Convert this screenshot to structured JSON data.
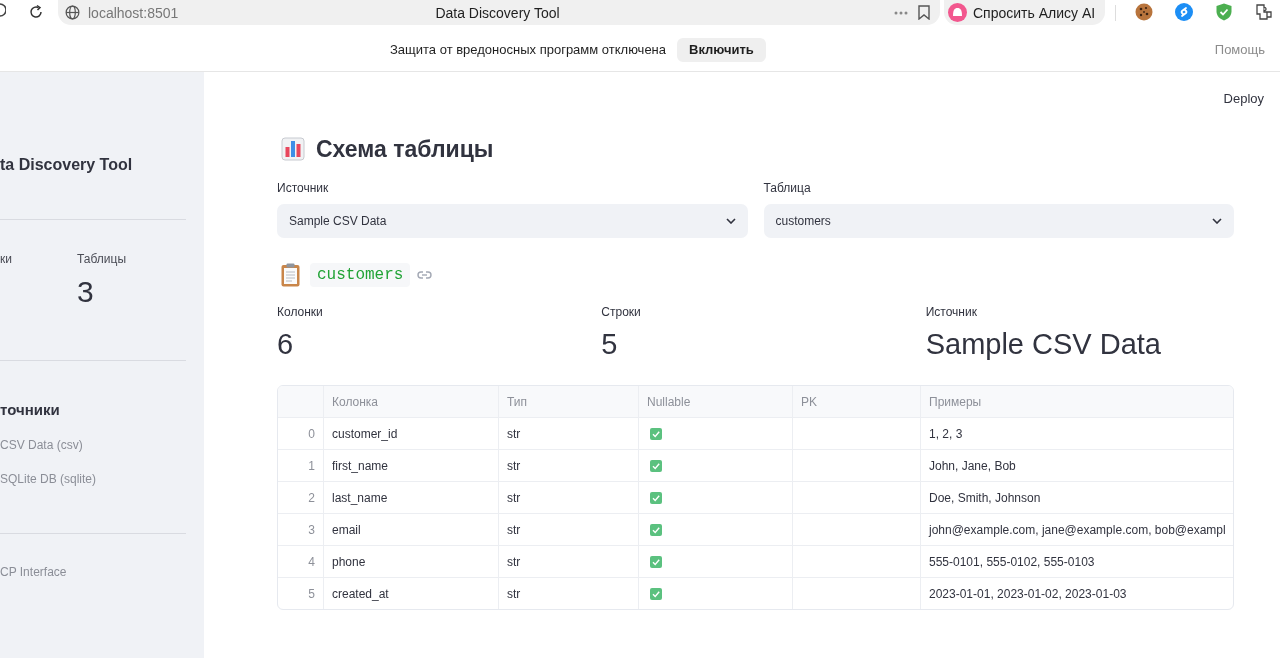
{
  "browser": {
    "address": "localhost:8501",
    "title": "Data Discovery Tool",
    "assistant": "Спросить Алису AI"
  },
  "infobar": {
    "message": "Защита от вредоносных программ отключена",
    "button": "Включить",
    "help": "Помощь"
  },
  "sidebar": {
    "title": "ta Discovery Tool",
    "metrics": [
      {
        "label": "ки"
      },
      {
        "label": "Таблицы",
        "value": "3"
      }
    ],
    "sources_heading": "точники",
    "sources": [
      "CSV Data (csv)",
      "SQLite DB (sqlite)"
    ],
    "footer": "CP Interface"
  },
  "header": {
    "deploy": "Deploy"
  },
  "main": {
    "title": "Схема таблицы",
    "selects": [
      {
        "label": "Источник",
        "value": "Sample CSV Data"
      },
      {
        "label": "Таблица",
        "value": "customers"
      }
    ],
    "table_name": "customers",
    "metrics": [
      {
        "label": "Колонки",
        "value": "6"
      },
      {
        "label": "Строки",
        "value": "5"
      },
      {
        "label": "Источник",
        "value": "Sample CSV Data"
      }
    ],
    "table": {
      "columns": [
        "Колонка",
        "Тип",
        "Nullable",
        "PK",
        "Примеры"
      ],
      "rows": [
        {
          "index": "0",
          "column": "customer_id",
          "type": "str",
          "nullable": true,
          "examples": "1, 2, 3"
        },
        {
          "index": "1",
          "column": "first_name",
          "type": "str",
          "nullable": true,
          "examples": "John, Jane, Bob"
        },
        {
          "index": "2",
          "column": "last_name",
          "type": "str",
          "nullable": true,
          "examples": "Doe, Smith, Johnson"
        },
        {
          "index": "3",
          "column": "email",
          "type": "str",
          "nullable": true,
          "examples": "john@example.com, jane@example.com, bob@exampl"
        },
        {
          "index": "4",
          "column": "phone",
          "type": "str",
          "nullable": true,
          "examples": "555-0101, 555-0102, 555-0103"
        },
        {
          "index": "5",
          "column": "created_at",
          "type": "str",
          "nullable": true,
          "examples": "2023-01-01, 2023-01-02, 2023-01-03"
        }
      ]
    }
  }
}
